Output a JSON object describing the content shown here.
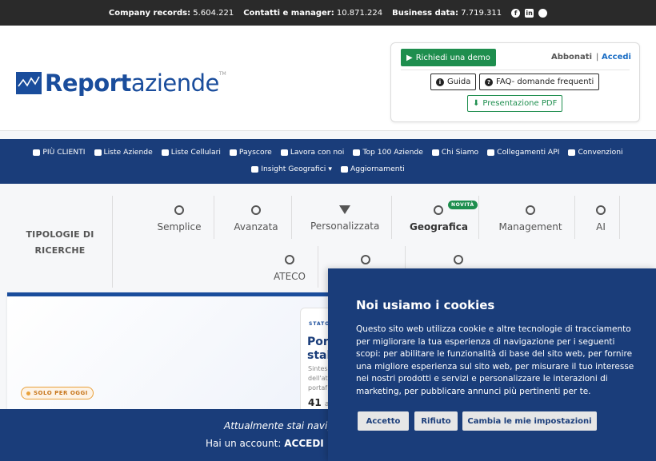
{
  "topbar": {
    "company_label": "Company records:",
    "company_value": "5.604.221",
    "contatti_label": "Contatti e manager:",
    "contatti_value": "10.871.224",
    "business_label": "Business data:",
    "business_value": "7.719.311"
  },
  "logo": {
    "bold": "Report",
    "light": "aziende",
    "tm": "TM"
  },
  "header": {
    "demo": "Richiedi una demo",
    "abbonati": "Abbonati",
    "pipe": "|",
    "accedi": "Accedi",
    "guida": "Guida",
    "faq": "FAQ- domande frequenti",
    "pdf": "Presentazione PDF"
  },
  "nav": {
    "row1": [
      "PIÙ CLIENTI",
      "Liste Aziende",
      "Liste Cellulari",
      "Payscore",
      "Lavora con noi",
      "Top 100 Aziende",
      "Chi Siamo",
      "Collegamenti API",
      "Convenzioni"
    ],
    "insight": "Insight Geografici",
    "aggiornamenti": "Aggiornamenti"
  },
  "ricerche": {
    "title": "TIPOLOGIE DI RICERCHE",
    "tabs": [
      "Semplice",
      "Avanzata",
      "Personalizzata",
      "Geografica",
      "Management",
      "AI",
      "ATECO"
    ],
    "badge": "NOVITÀ"
  },
  "hero": {
    "stato": "STATO",
    "title_1": "Port",
    "title_2": "stab",
    "sub_1": "Sintesi",
    "sub_2": "dell'at",
    "sub_3": "portaf",
    "num": "41",
    "num_suffix": "a",
    "solo": "SOLO PER OGGI"
  },
  "bottom": {
    "line1": "Attualmente stai navig",
    "line2_pre": "Hai un account: ",
    "line2_link": "ACCEDI",
    "line2_post": " | V"
  },
  "cookie": {
    "title": "Noi usiamo i cookies",
    "text": "Questo sito web utilizza cookie e altre tecnologie di tracciamento per migliorare la tua esperienza di navigazione per i seguenti scopi: per abilitare le funzionalità di base del sito web, per fornire una migliore esperienza sul sito web, per misurare il tuo interesse nei nostri prodotti e servizi e personalizzare le interazioni di marketing, per pubblicare annunci più pertinenti per te.",
    "accetto": "Accetto",
    "rifiuto": "Rifiuto",
    "cambia": "Cambia le mie impostazioni"
  },
  "colors": {
    "navy": "#1a3d7a",
    "brand_blue": "#1a4d9c",
    "green": "#1e8e4e",
    "orange": "#e9a13b"
  }
}
